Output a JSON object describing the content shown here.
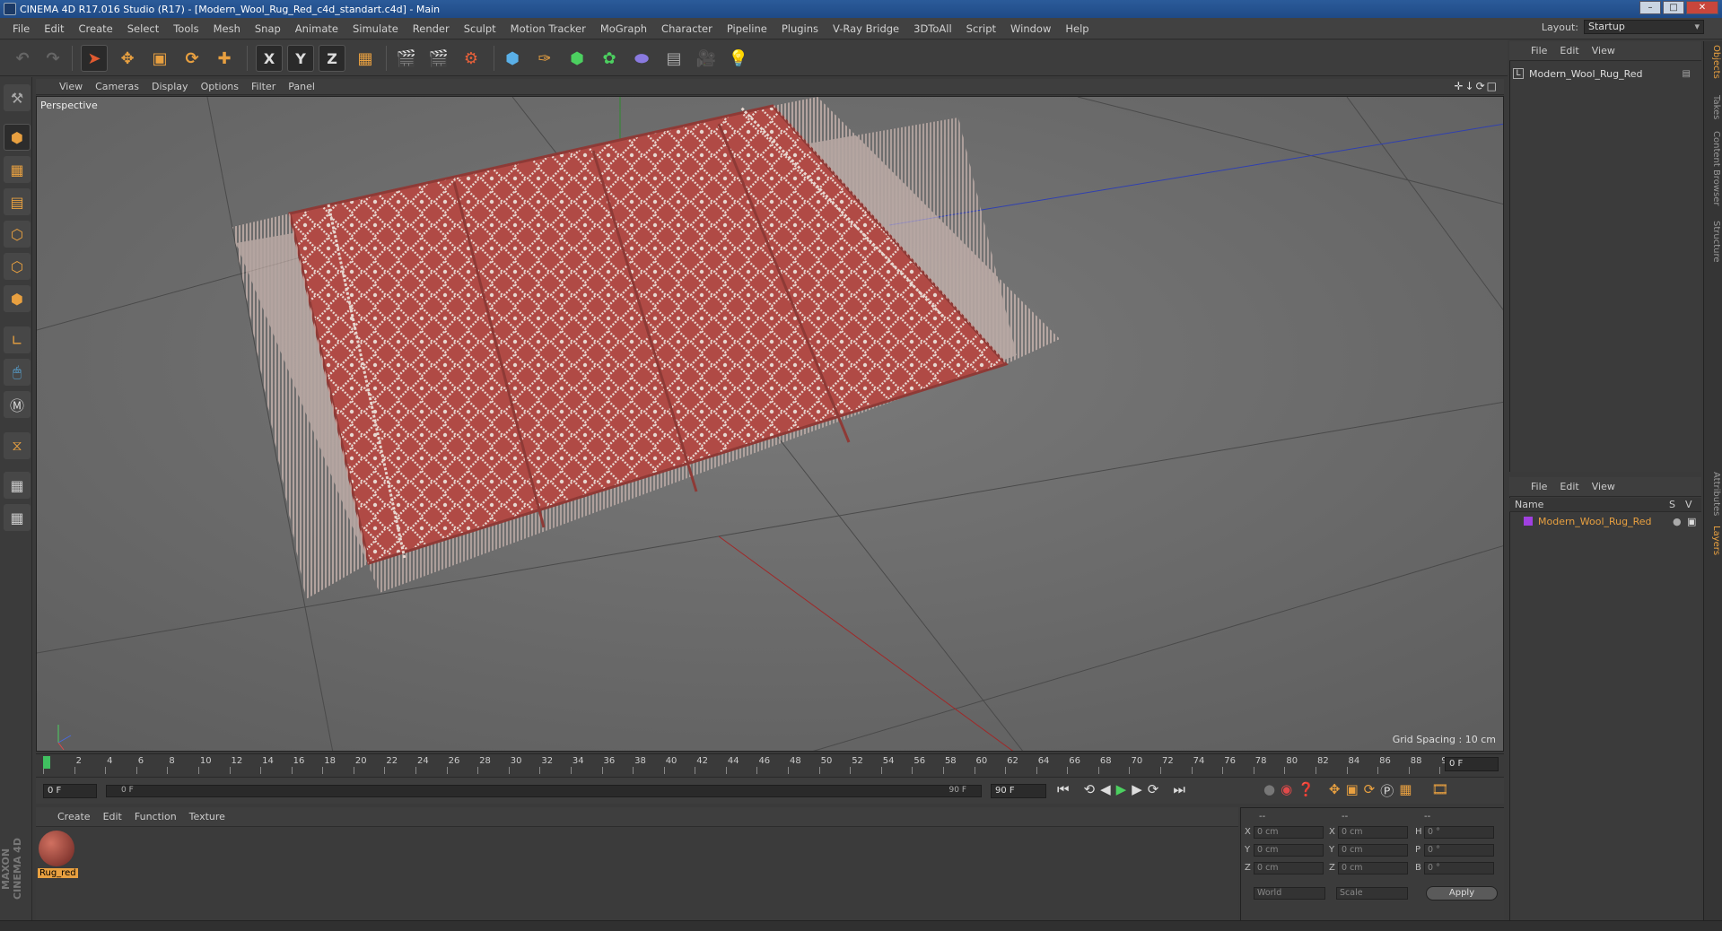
{
  "window": {
    "title": "CINEMA 4D R17.016 Studio (R17) - [Modern_Wool_Rug_Red_c4d_standart.c4d] - Main"
  },
  "menu": [
    "File",
    "Edit",
    "Create",
    "Select",
    "Tools",
    "Mesh",
    "Snap",
    "Animate",
    "Simulate",
    "Render",
    "Sculpt",
    "Motion Tracker",
    "MoGraph",
    "Character",
    "Pipeline",
    "Plugins",
    "V-Ray Bridge",
    "3DToAll",
    "Script",
    "Window",
    "Help"
  ],
  "layout": {
    "label": "Layout:",
    "value": "Startup"
  },
  "toolbar": {
    "x_label": "X",
    "y_label": "Y",
    "z_label": "Z"
  },
  "viewport": {
    "menu": [
      "View",
      "Cameras",
      "Display",
      "Options",
      "Filter",
      "Panel"
    ],
    "label": "Perspective",
    "grid_spacing": "Grid Spacing : 10 cm",
    "nav_icons": "✛↓⟳□"
  },
  "timeline": {
    "ticks": [
      "0",
      "2",
      "4",
      "6",
      "8",
      "10",
      "12",
      "14",
      "16",
      "18",
      "20",
      "22",
      "24",
      "26",
      "28",
      "30",
      "32",
      "34",
      "36",
      "38",
      "40",
      "42",
      "44",
      "46",
      "48",
      "50",
      "52",
      "54",
      "56",
      "58",
      "60",
      "62",
      "64",
      "66",
      "68",
      "70",
      "72",
      "74",
      "76",
      "78",
      "80",
      "82",
      "84",
      "86",
      "88",
      "90"
    ],
    "current_frame": "0 F",
    "start_field": "0 F",
    "range_start": "0 F",
    "range_end": "90 F",
    "end_field": "90 F"
  },
  "materials": {
    "menu": [
      "Create",
      "Edit",
      "Function",
      "Texture"
    ],
    "items": [
      {
        "name": "Rug_red"
      }
    ]
  },
  "coords": {
    "headers": [
      "--",
      "--",
      "--"
    ],
    "rows": [
      {
        "a": "X",
        "av": "0 cm",
        "b": "X",
        "bv": "0 cm",
        "c": "H",
        "cv": "0 °"
      },
      {
        "a": "Y",
        "av": "0 cm",
        "b": "Y",
        "bv": "0 cm",
        "c": "P",
        "cv": "0 °"
      },
      {
        "a": "Z",
        "av": "0 cm",
        "b": "Z",
        "bv": "0 cm",
        "c": "B",
        "cv": "0 °"
      }
    ],
    "world": "World",
    "scale": "Scale",
    "apply": "Apply"
  },
  "objects": {
    "menu": [
      "File",
      "Edit",
      "View"
    ],
    "items": [
      {
        "name": "Modern_Wool_Rug_Red"
      }
    ]
  },
  "layers": {
    "menu": [
      "File",
      "Edit",
      "View"
    ],
    "col_name": "Name",
    "col_s": "S",
    "col_v": "V",
    "items": [
      {
        "name": "Modern_Wool_Rug_Red",
        "color": "#a040e0"
      }
    ]
  },
  "right_tabs": [
    "Objects",
    "Takes",
    "Content Browser",
    "Structure",
    "Attributes",
    "Layers"
  ],
  "brand": "MAXON CINEMA 4D",
  "colors": {
    "accent": "#e8a040",
    "rug": "#b54a44",
    "viewport_bg": "#6f6f6f"
  }
}
